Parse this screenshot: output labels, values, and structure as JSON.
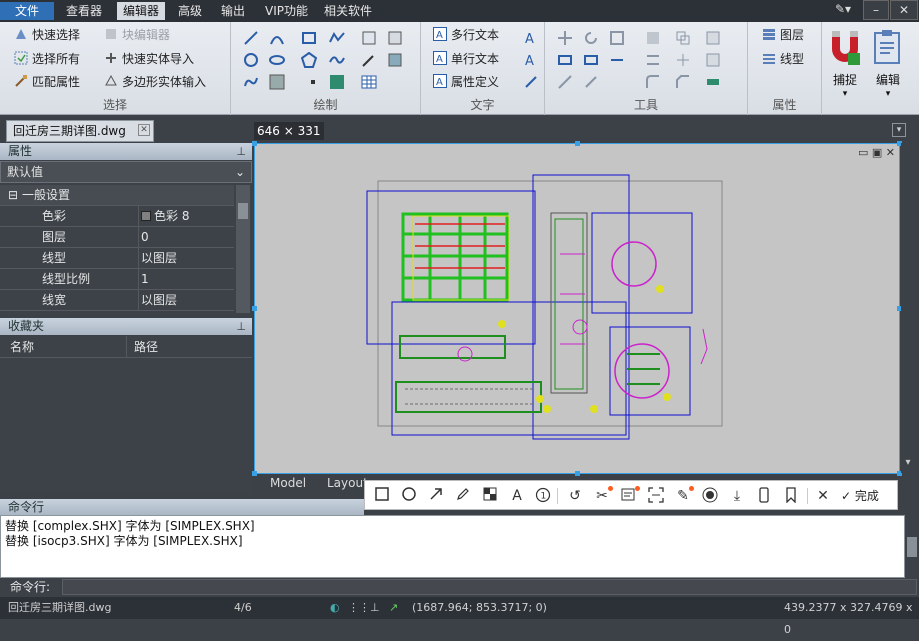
{
  "menubar": {
    "items": [
      "文件",
      "查看器",
      "编辑器",
      "高级",
      "输出",
      "VIP功能",
      "相关软件"
    ],
    "active": "编辑器"
  },
  "ribbon": {
    "select": {
      "label": "选择",
      "quick_select": "快速选择",
      "block_editor": "块编辑器",
      "select_all": "选择所有",
      "quick_entity_import": "快速实体导入",
      "match_props": "匹配属性",
      "polygon_entity_input": "多边形实体输入"
    },
    "draw": {
      "label": "绘制"
    },
    "text": {
      "label": "文字",
      "mtext": "多行文本",
      "stext": "单行文本",
      "attdef": "属性定义"
    },
    "tools": {
      "label": "工具"
    },
    "props": {
      "label": "属性",
      "layer": "图层",
      "linetype": "线型"
    },
    "snap": "捕捉",
    "edit": "编辑"
  },
  "document": {
    "tab": "回迁房三期详图.dwg"
  },
  "selection_size": "646 × 331",
  "properties_panel": {
    "title": "属性",
    "preset": "默认值",
    "group": "一般设置",
    "rows": [
      {
        "key": "色彩",
        "value": "色彩 8"
      },
      {
        "key": "图层",
        "value": "0"
      },
      {
        "key": "线型",
        "value": "以图层"
      },
      {
        "key": "线型比例",
        "value": "1"
      },
      {
        "key": "线宽",
        "value": "以图层"
      }
    ]
  },
  "favorites_panel": {
    "title": "收藏夹",
    "col_name": "名称",
    "col_path": "路径"
  },
  "layout_tabs": [
    "Model",
    "Layout"
  ],
  "shot_toolbar": {
    "done": "完成"
  },
  "command": {
    "title": "命令行",
    "log": [
      "替换 [complex.SHX] 字体为 [SIMPLEX.SHX]",
      "替换 [isocp3.SHX] 字体为 [SIMPLEX.SHX]"
    ],
    "prompt": "命令行:"
  },
  "status": {
    "file": "回迁房三期详图.dwg",
    "page": "4/6",
    "coords": "(1687.964; 853.3717; 0)",
    "size": "439.2377 x 327.4769 x 0"
  },
  "colors": {
    "accent": "#3aa0e6",
    "drawing_bg": "#c5c5c5",
    "marker": "#ff5a1f"
  }
}
